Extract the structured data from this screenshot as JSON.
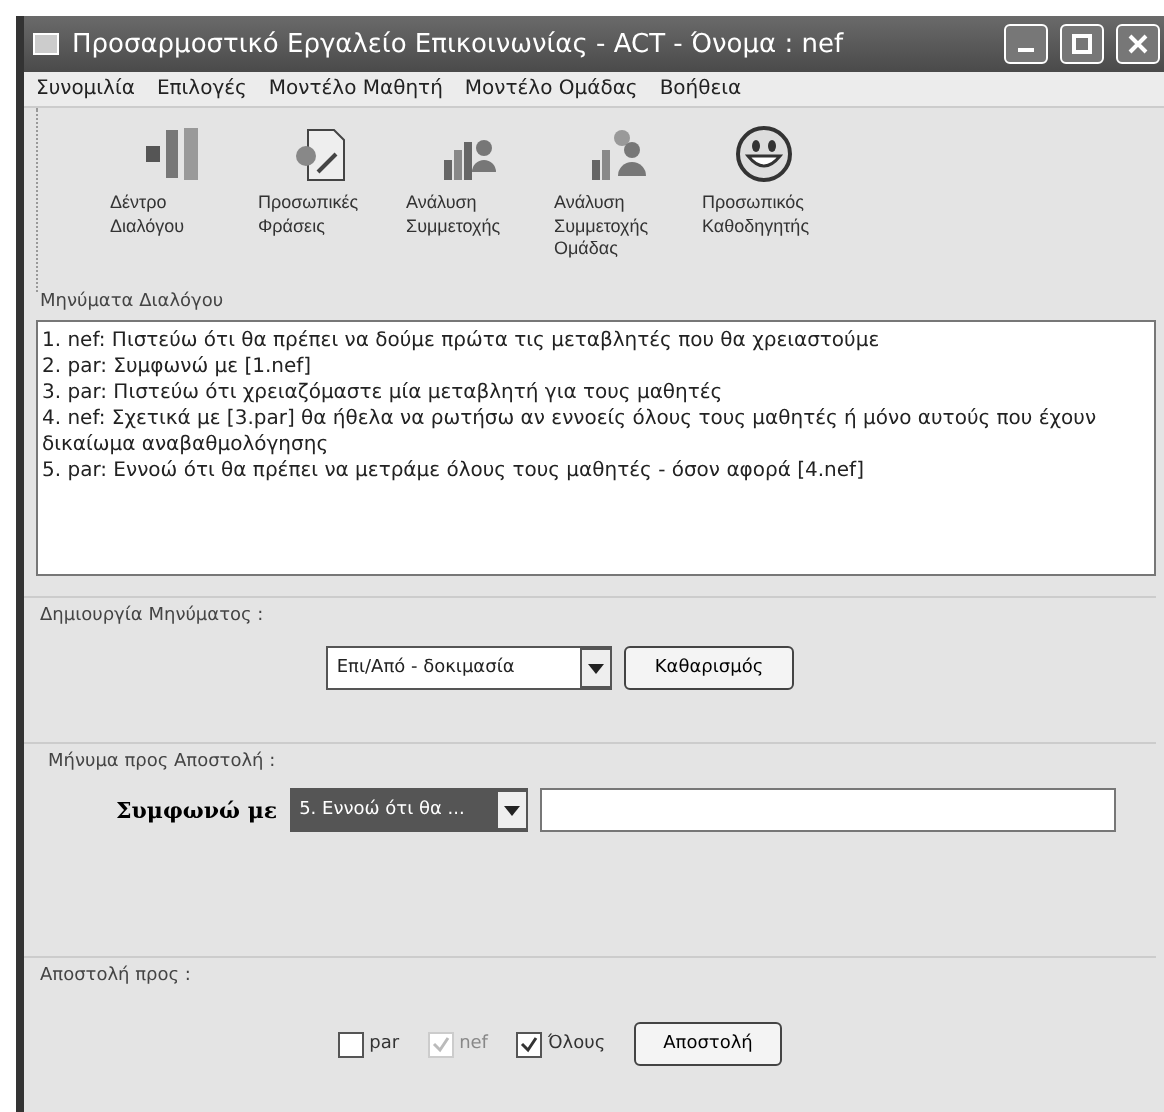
{
  "window": {
    "title": "Προσαρμοστικό Εργαλείο Επικοινωνίας - ACT - Όνομα : nef"
  },
  "menu": [
    "Συνομιλία",
    "Επιλογές",
    "Μοντέλο Μαθητή",
    "Μοντέλο Ομάδας",
    "Βοήθεια"
  ],
  "toolbar": [
    {
      "kind": "tree",
      "label": "Δέντρο Διαλόγου"
    },
    {
      "kind": "document",
      "label": "Προσωπικές Φράσεις"
    },
    {
      "kind": "chart-person",
      "label": "Ανάλυση Συμμετοχής"
    },
    {
      "kind": "chart-group",
      "label": "Ανάλυση Συμμετοχής Ομάδας"
    },
    {
      "kind": "smiley",
      "label": "Προσωπικός Καθοδηγητής"
    }
  ],
  "dialogue": {
    "label": "Μηνύματα Διαλόγου",
    "messages": [
      "1. nef:  Πιστεύω ότι θα πρέπει να δούμε πρώτα τις μεταβλητές που θα χρειαστούμε",
      "2. par:  Συμφωνώ με [1.nef]",
      "3. par:  Πιστεύω ότι χρειαζόμαστε μία μεταβλητή για τους μαθητές",
      "4. nef:  Σχετικά με  [3.par] θα ήθελα να ρωτήσω αν εννοείς όλους τους μαθητές ή μόνο αυτούς που έχουν δικαίωμα αναβαθμολόγησης",
      "5. par:  Εννοώ ότι θα πρέπει να μετράμε όλους τους μαθητές - όσον αφορά [4.nef]"
    ]
  },
  "create": {
    "label": "Δημιουργία Μηνύματος :",
    "combo": "Επι/Από - δοκιμασία",
    "button": "Καθαρισμός"
  },
  "compose": {
    "label": "Μήνυμα προς Αποστολή :",
    "prefix": "Συμφωνώ με",
    "reference": "5. Εννοώ ότι θα ..."
  },
  "send": {
    "label": "Αποστολή προς :",
    "recipients": [
      {
        "label": "par",
        "checked": false,
        "disabled": false
      },
      {
        "label": "nef",
        "checked": true,
        "disabled": true
      },
      {
        "label": "Όλους",
        "checked": true,
        "disabled": false
      }
    ],
    "button": "Αποστολή"
  }
}
